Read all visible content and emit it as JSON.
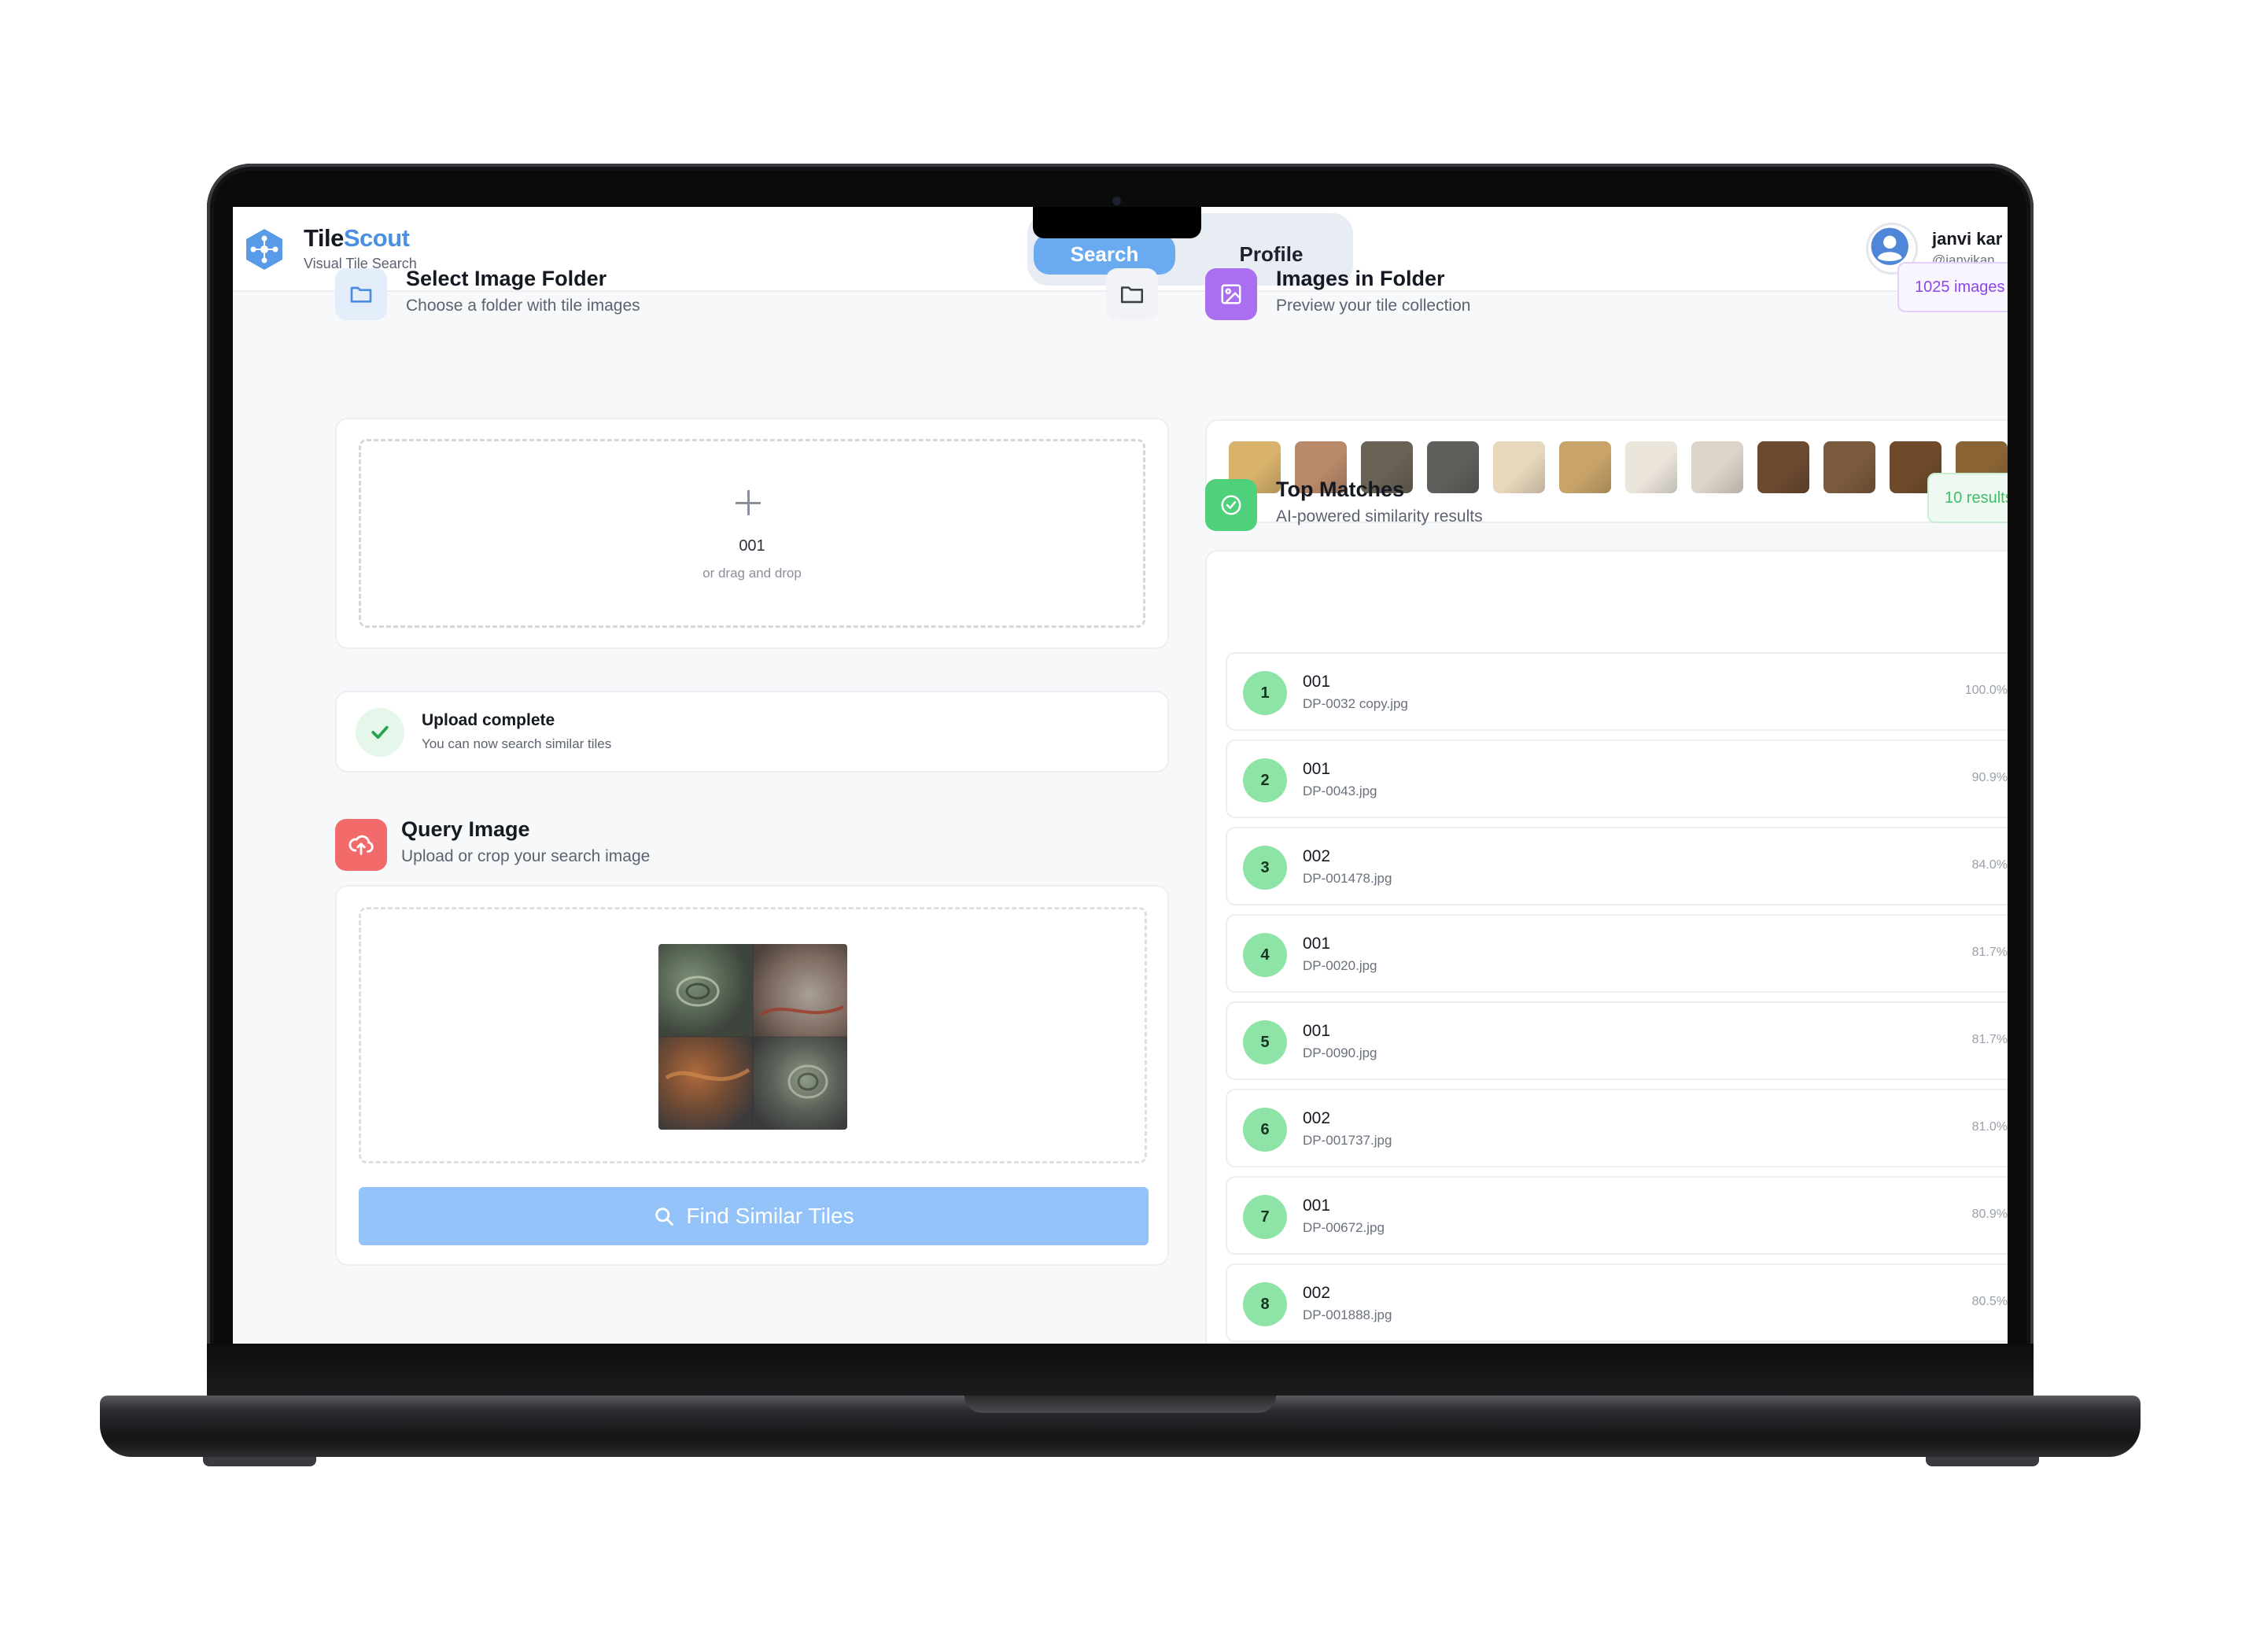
{
  "header": {
    "brand_part1": "Tile",
    "brand_part2": "Scout",
    "subtitle": "Visual Tile Search",
    "tabs": [
      {
        "label": "Search",
        "active": true
      },
      {
        "label": "Profile",
        "active": false
      }
    ],
    "user": {
      "name": "janvi kar",
      "handle": "@janvikan"
    }
  },
  "folder_section": {
    "title": "Select Image Folder",
    "subtitle": "Choose a folder with tile images",
    "dropzone_text": "001",
    "dropzone_hint": "or drag and drop"
  },
  "upload_status": {
    "title": "Upload complete",
    "subtitle": "You can now search similar tiles"
  },
  "query_section": {
    "title": "Query Image",
    "subtitle": "Upload or crop your search image",
    "button_label": "Find Similar Tiles"
  },
  "images_section": {
    "title": "Images in Folder",
    "subtitle": "Preview your tile collection",
    "badge": "1025 images",
    "thumbnails": [
      "#d9b36c",
      "#b98a6a",
      "#6a6254",
      "#5e605c",
      "#e7d7bc",
      "#c8a46a",
      "#ebe5dc",
      "#dcd4c8",
      "#6b4a30",
      "#7a5a3c",
      "#6e4a2a",
      "#8a6434"
    ]
  },
  "matches_section": {
    "title": "Top Matches",
    "subtitle": "AI-powered similarity results",
    "badge": "10 results",
    "items": [
      {
        "rank": "1",
        "title": "001",
        "file": "DP-0032 copy.jpg",
        "score": "100.0%"
      },
      {
        "rank": "2",
        "title": "001",
        "file": "DP-0043.jpg",
        "score": "90.9%"
      },
      {
        "rank": "3",
        "title": "002",
        "file": "DP-001478.jpg",
        "score": "84.0%"
      },
      {
        "rank": "4",
        "title": "001",
        "file": "DP-0020.jpg",
        "score": "81.7%"
      },
      {
        "rank": "5",
        "title": "001",
        "file": "DP-0090.jpg",
        "score": "81.7%"
      },
      {
        "rank": "6",
        "title": "002",
        "file": "DP-001737.jpg",
        "score": "81.0%"
      },
      {
        "rank": "7",
        "title": "001",
        "file": "DP-00672.jpg",
        "score": "80.9%"
      },
      {
        "rank": "8",
        "title": "002",
        "file": "DP-001888.jpg",
        "score": "80.5%"
      }
    ]
  },
  "colors": {
    "accent_blue": "#6aaaf0",
    "button_blue": "#93c3f8",
    "purple": "#a96ff0",
    "green": "#4fd07a",
    "red": "#f26a6a"
  }
}
